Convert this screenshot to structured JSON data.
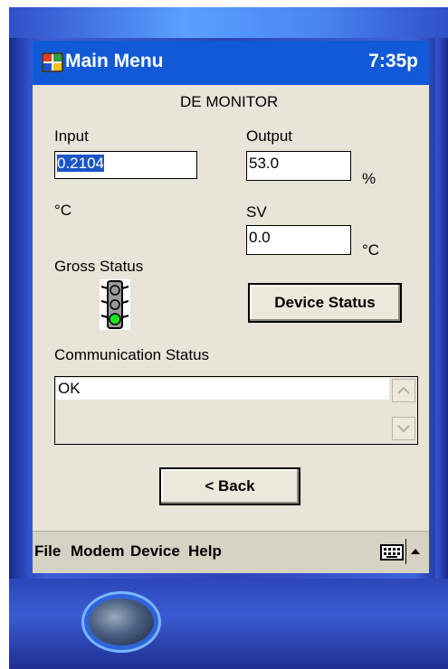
{
  "titlebar": {
    "app_icon": "window-grid-icon",
    "title": "Main Menu",
    "time": "7:35p"
  },
  "form": {
    "heading": "DE MONITOR",
    "input_label": "Input",
    "input_value": "0.2104",
    "input_unit": "°C",
    "output_label": "Output",
    "output_value": "53.0",
    "output_unit": "%",
    "sv_label": "SV",
    "sv_value": "0.0",
    "sv_unit": "°C",
    "gross_status_label": "Gross Status",
    "traffic_light_icon": "traffic-light-icon",
    "traffic_light_state": "green",
    "device_status_button": "Device Status",
    "comm_status_label": "Communication Status",
    "comm_status_text": "OK",
    "back_button": "< Back"
  },
  "menubar": {
    "items": [
      "File",
      "Modem",
      "Device",
      "Help"
    ],
    "keyboard_icon": "keyboard-icon",
    "sip_arrow_icon": "up-arrow-icon"
  },
  "colors": {
    "titlebar": "#1159d6",
    "screen_bg": "#e8e4d8",
    "selection": "#1b55c8"
  }
}
